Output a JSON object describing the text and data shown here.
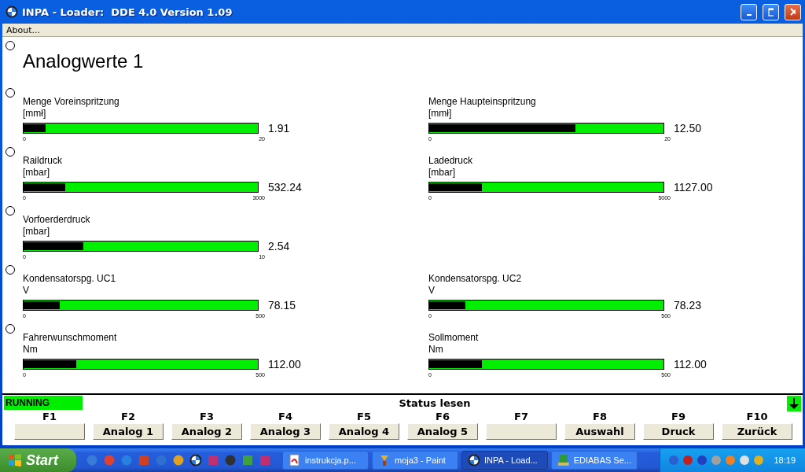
{
  "window": {
    "title": "INPA - Loader:  DDE 4.0 Version 1.09"
  },
  "menu": [
    "About..."
  ],
  "heading": "Analogwerte 1",
  "gauge_rows": [
    {
      "left": {
        "label": "Menge Voreinspritzung",
        "unit": "[mmł]",
        "level": 0.095,
        "min": "0",
        "max": "20",
        "reading": "1.91"
      },
      "right": {
        "label": "Menge Haupteinspritzung",
        "unit": "[mmł]",
        "level": 0.625,
        "min": "0",
        "max": "20",
        "reading": "12.50"
      }
    },
    {
      "left": {
        "label": "Raildruck",
        "unit": "[mbar]",
        "level": 0.177,
        "min": "0",
        "max": "3000",
        "reading": "532.24"
      },
      "right": {
        "label": "Ladedruck",
        "unit": "[mbar]",
        "level": 0.225,
        "min": "0",
        "max": "5000",
        "reading": "1127.00"
      }
    },
    {
      "left": {
        "label": "Vorfoerderdruck",
        "unit": "[mbar]",
        "level": 0.254,
        "min": "0",
        "max": "10",
        "reading": "2.54"
      }
    },
    {
      "left": {
        "label": "Kondensatorspg. UC1",
        "unit": "V",
        "level": 0.156,
        "min": "0",
        "max": "500",
        "reading": "78.15"
      },
      "right": {
        "label": "Kondensatorspg. UC2",
        "unit": "V",
        "level": 0.156,
        "min": "0",
        "max": "500",
        "reading": "78.23"
      }
    },
    {
      "left": {
        "label": "Fahrerwunschmoment",
        "unit": "Nm",
        "level": 0.224,
        "min": "0",
        "max": "500",
        "reading": "112.00"
      },
      "right": {
        "label": "Sollmoment",
        "unit": "Nm",
        "level": 0.224,
        "min": "0",
        "max": "500",
        "reading": "112.00"
      }
    }
  ],
  "status_bar": {
    "state": "RUNNING",
    "message": "Status lesen"
  },
  "function_keys": [
    {
      "key": "F1"
    },
    {
      "key": "F2",
      "label": "Analog 1"
    },
    {
      "key": "F3",
      "label": "Analog 2"
    },
    {
      "key": "F4",
      "label": "Analog 3"
    },
    {
      "key": "F5",
      "label": "Analog 4"
    },
    {
      "key": "F6",
      "label": "Analog 5"
    },
    {
      "key": "F7"
    },
    {
      "key": "F8",
      "label": "Auswahl"
    },
    {
      "key": "F9",
      "label": "Druck"
    },
    {
      "key": "F10",
      "label": "Zurück"
    }
  ],
  "taskbar": {
    "start": "Start",
    "tasks": [
      {
        "kind": "document",
        "label": "instrukcja.p...",
        "selected": false
      },
      {
        "kind": "brush",
        "label": "moja3 - Paint",
        "selected": false
      },
      {
        "kind": "roundel",
        "label": "INPA - Load...",
        "selected": true
      },
      {
        "kind": "installer",
        "label": "EDIABAS Se...",
        "selected": false
      }
    ],
    "clock": "18:19"
  }
}
